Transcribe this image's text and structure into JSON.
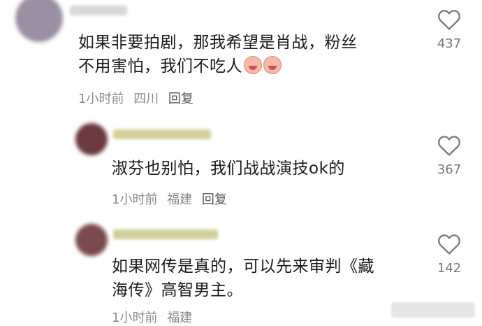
{
  "comments": [
    {
      "text_line1": "如果非要拍剧，那我希望是肖战，粉丝",
      "text_line2": "不用害怕，我们不吃人",
      "time": "1小时前",
      "location": "四川",
      "reply": "回复",
      "likes": "437"
    },
    {
      "text_line1": "淑芬也别怕，我们战战演技ok的",
      "time": "1小时前",
      "location": "福建",
      "reply": "回复",
      "likes": "367"
    },
    {
      "text_line1": "如果网传是真的，可以先来审判《藏",
      "text_line2": "海传》高智男主。",
      "time": "1小时前",
      "location": "福建",
      "likes": "142"
    }
  ],
  "icons": {
    "like": "heart-outline-icon",
    "emoji": "crying-face-emoji"
  },
  "colors": {
    "text": "#1a1a1a",
    "meta": "#8a8a8a",
    "icon": "#777777"
  }
}
